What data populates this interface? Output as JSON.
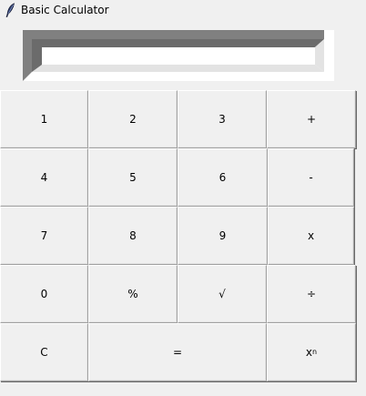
{
  "window": {
    "title": "Basic Calculator",
    "icon": "feather-icon"
  },
  "display": {
    "value": ""
  },
  "buttons": {
    "b1": "1",
    "b2": "2",
    "b3": "3",
    "plus": "+",
    "b4": "4",
    "b5": "5",
    "b6": "6",
    "minus": "-",
    "b7": "7",
    "b8": "8",
    "b9": "9",
    "multiply": "x",
    "b0": "0",
    "percent": "%",
    "sqrt": "√",
    "divide": "÷",
    "clear": "C",
    "equals": "=",
    "power_base": "x",
    "power_exp": "n"
  }
}
